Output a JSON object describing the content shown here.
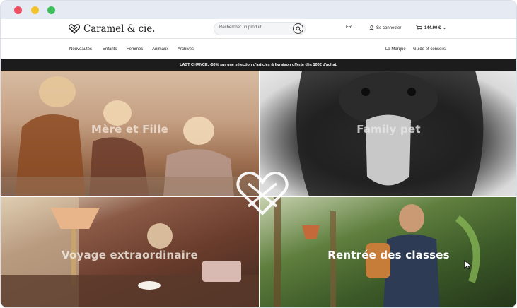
{
  "chrome": {
    "dots": [
      "red",
      "yellow",
      "green"
    ]
  },
  "header": {
    "logo_text": "Caramel & cie.",
    "logo_icon": "heart-knot-icon",
    "search": {
      "placeholder": "Rechercher un produit",
      "icon": "search-icon"
    },
    "language": "FR",
    "login_label": "Se connecter",
    "login_icon": "user-icon",
    "cart_total": "144.90 €",
    "cart_icon": "cart-icon"
  },
  "nav": {
    "left": [
      "Nouveautés",
      "Enfants",
      "Femmes",
      "Animaux",
      "Archives"
    ],
    "right": [
      "La Marque",
      "Guide et conseils"
    ]
  },
  "banner": {
    "text": "LAST CHANCE, -50% sur une sélection d'articles & livraison offerte dès 100€ d'achat."
  },
  "tiles": [
    {
      "label": "Mère et Fille"
    },
    {
      "label": "Family pet"
    },
    {
      "label": "Voyage extraordinaire"
    },
    {
      "label": "Rentrée des classes"
    }
  ],
  "colors": {
    "banner_bg": "#1c1c1c",
    "chrome_bg": "#e6ebf3",
    "text": "#222222"
  }
}
